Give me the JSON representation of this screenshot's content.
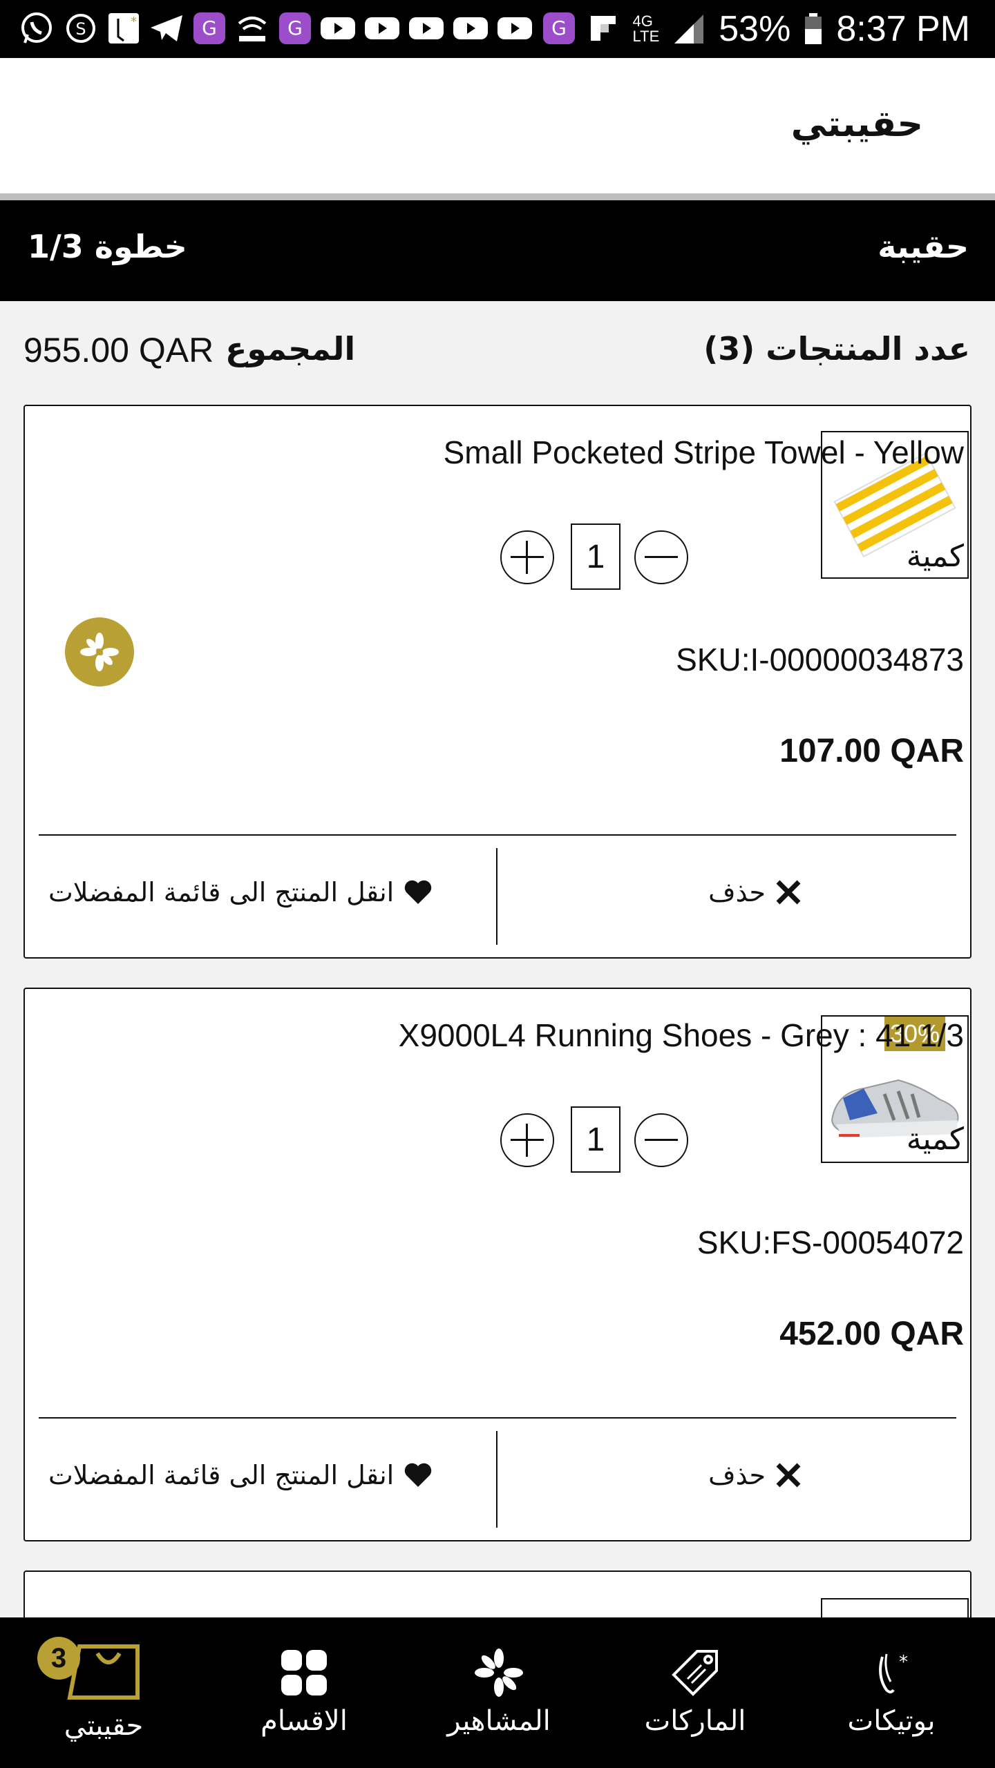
{
  "status_bar": {
    "battery": "53%",
    "time": "8:37 PM"
  },
  "header": {
    "title": "حقيبتي"
  },
  "step_bar": {
    "left": "خطوة 1/3",
    "right": "حقيبة"
  },
  "summary": {
    "count_label": "عدد المنتجات",
    "count_value": "(3)",
    "total_label": "المجموع",
    "total_value": "955.00 QAR"
  },
  "products": [
    {
      "title": "Small Pocketed Stripe Towel - Yellow",
      "qty_label": "كمية",
      "qty": "1",
      "sku": "SKU:I-00000034873",
      "price": "107.00 QAR",
      "delete_label": "حذف",
      "wishlist_label": "انقل المنتج الى قائمة المفضلات"
    },
    {
      "title": "X9000L4 Running Shoes - Grey : 41 1/3",
      "qty_label": "كمية",
      "qty": "1",
      "sku": "SKU:FS-00054072",
      "price": "452.00 QAR",
      "discount_badge": "30%",
      "delete_label": "حذف",
      "wishlist_label": "انقل المنتج الى قائمة المفضلات"
    }
  ],
  "bottom_nav": {
    "cart_count": "3",
    "items": [
      {
        "label": "حقيبتي",
        "icon": "bag-icon"
      },
      {
        "label": "الاقسام",
        "icon": "grid-icon"
      },
      {
        "label": "المشاهير",
        "icon": "flower-icon"
      },
      {
        "label": "الماركات",
        "icon": "tag-icon"
      },
      {
        "label": "بوتيكات",
        "icon": "boutique-icon"
      }
    ]
  },
  "colors": {
    "accent_gold": "#b8a034",
    "bar_black": "#000000",
    "background": "#f2f2f2"
  }
}
